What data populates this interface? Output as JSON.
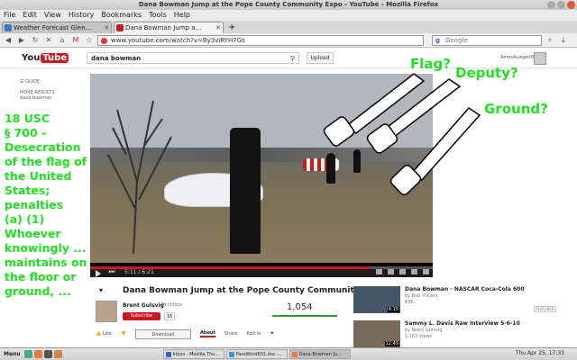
{
  "window": {
    "title": "Dana Bowman Jump at the Pope County Community Expo - YouTube - Mozilla Firefox"
  },
  "menu": [
    "File",
    "Edit",
    "View",
    "History",
    "Bookmarks",
    "Tools",
    "Help"
  ],
  "tabs": [
    {
      "label": "Weather Forecast Glen...",
      "active": false
    },
    {
      "label": "Dana Bowman Jump a...",
      "active": true
    }
  ],
  "navbar": {
    "url": "www.youtube.com/watch?v=By3viRYH7Gs",
    "search_placeholder": "Google"
  },
  "youtube": {
    "logo_you": "You",
    "logo_tube": "Tube",
    "search_value": "dana bowman",
    "upload_label": "Upload",
    "user_name": "AmesAudgett8",
    "guide_label": "GUIDE",
    "more_results_label": "MORE RESULTS",
    "more_results_sub": "dana bowman"
  },
  "video": {
    "time": "5:11 / 6:21",
    "progress": 0.82
  },
  "overlay": {
    "left_text": "18 USC\n§ 700 -\nDesecration\nof the flag of\nthe United\nStates;\npenalties\n(a) (1)\nWhoever\nknowingly ...\nmaintains on\nthe floor or\nground, ...",
    "flag_label": "Flag?",
    "deputy_label": "Deputy?",
    "ground_label": "Ground?"
  },
  "info": {
    "title": "Dana Bowman Jump at the Pope County Community Expo",
    "channel": "Brent Gulsvig",
    "channel_videos": "44 videos",
    "subscribe_label": "Subscribe",
    "subscriber_count": "16",
    "views": "1,054",
    "like_label": "Like",
    "download_label": "Download",
    "about_label": "About",
    "share_label": "Share",
    "addto_label": "Add to"
  },
  "sidebar": [
    {
      "title": "Dana Bowman - NASCAR Coca-Cola 600",
      "by": "by Bob Vilcans",
      "views": "636",
      "duration": "4:15",
      "badge": "FEATURED"
    },
    {
      "title": "Sammy L. Davis Raw Interview 5-6-10",
      "by": "by Brent Gulsvig",
      "views": "1,163 views",
      "duration": "12:49",
      "badge": ""
    }
  ],
  "taskbar": {
    "menu_label": "Menu",
    "tasks": [
      "Inbox - Mozilla Thu...",
      "PassWord601.doc -...",
      "Dana Bowman Ju..."
    ],
    "clock": "Thu Apr 25, 17:33"
  }
}
